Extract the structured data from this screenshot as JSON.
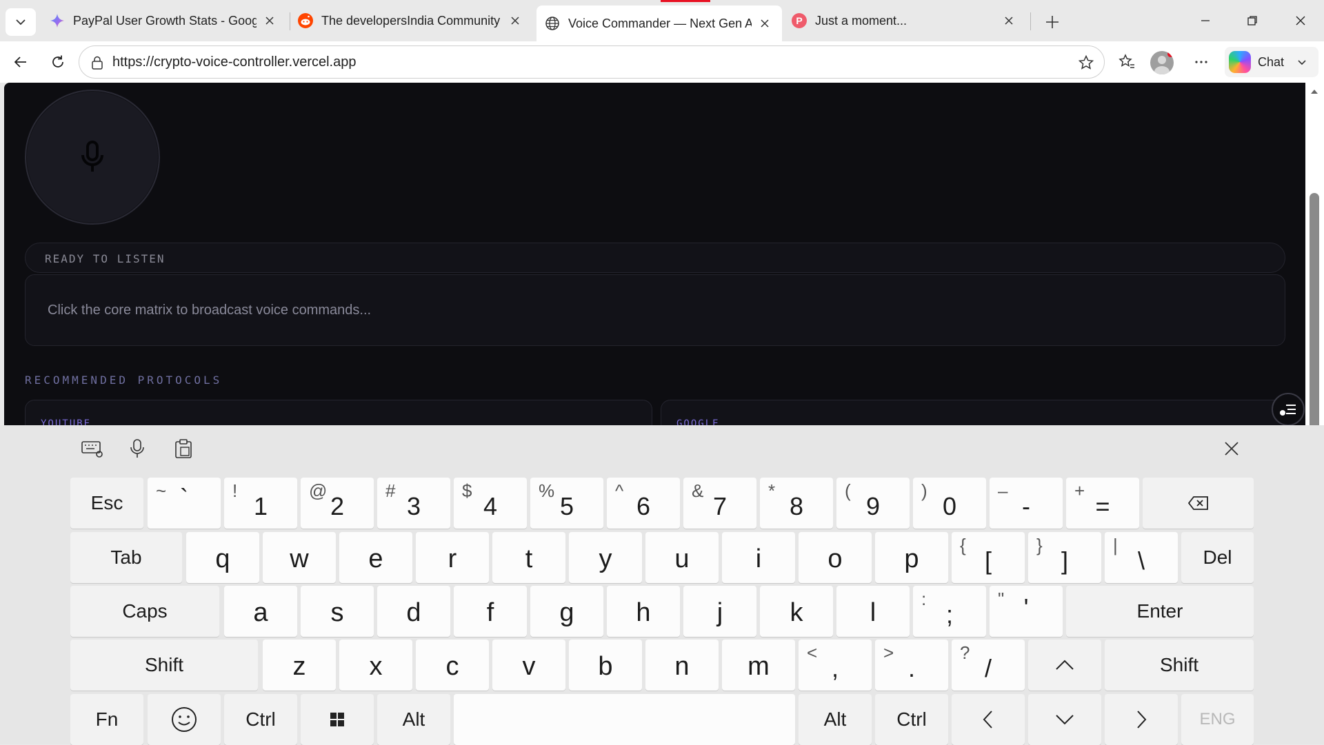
{
  "tabs": [
    {
      "title": "PayPal User Growth Stats - Google",
      "favicon": "gemini-sparkle-icon"
    },
    {
      "title": "The developersIndia Community",
      "favicon": "reddit-icon"
    },
    {
      "title": "Voice Commander — Next Gen AI",
      "favicon": "globe-icon",
      "active": true
    },
    {
      "title": "Just a moment...",
      "favicon": "perplexity-p-icon"
    }
  ],
  "toolbar": {
    "url": "https://crypto-voice-controller.vercel.app",
    "chat_label": "Chat"
  },
  "page": {
    "status": "READY TO LISTEN",
    "transcript_placeholder": "Click the core matrix to broadcast voice commands...",
    "section_label": "RECOMMENDED PROTOCOLS",
    "cards": [
      "YOUTUBE",
      "GOOGLE"
    ]
  },
  "keyboard": {
    "row1": [
      {
        "main": "Esc"
      },
      {
        "sub": "~",
        "main": "`"
      },
      {
        "sub": "!",
        "main": "1"
      },
      {
        "sub": "@",
        "main": "2"
      },
      {
        "sub": "#",
        "main": "3"
      },
      {
        "sub": "$",
        "main": "4"
      },
      {
        "sub": "%",
        "main": "5"
      },
      {
        "sub": "^",
        "main": "6"
      },
      {
        "sub": "&",
        "main": "7"
      },
      {
        "sub": "*",
        "main": "8"
      },
      {
        "sub": "(",
        "main": "9"
      },
      {
        "sub": ")",
        "main": "0"
      },
      {
        "sub": "–",
        "main": "-"
      },
      {
        "sub": "+",
        "main": "="
      }
    ],
    "row2": [
      {
        "main": "Tab"
      },
      {
        "main": "q"
      },
      {
        "main": "w"
      },
      {
        "main": "e"
      },
      {
        "main": "r"
      },
      {
        "main": "t"
      },
      {
        "main": "y"
      },
      {
        "main": "u"
      },
      {
        "main": "i"
      },
      {
        "main": "o"
      },
      {
        "main": "p"
      },
      {
        "sub": "{",
        "main": "["
      },
      {
        "sub": "}",
        "main": "]"
      },
      {
        "sub": "|",
        "main": "\\"
      },
      {
        "main": "Del"
      }
    ],
    "row3": [
      {
        "main": "Caps"
      },
      {
        "main": "a"
      },
      {
        "main": "s"
      },
      {
        "main": "d"
      },
      {
        "main": "f"
      },
      {
        "main": "g"
      },
      {
        "main": "h"
      },
      {
        "main": "j"
      },
      {
        "main": "k"
      },
      {
        "main": "l"
      },
      {
        "sub": ":",
        "main": ";"
      },
      {
        "sub": "\"",
        "main": "'"
      },
      {
        "main": "Enter"
      }
    ],
    "row4": [
      {
        "main": "Shift"
      },
      {
        "main": "z"
      },
      {
        "main": "x"
      },
      {
        "main": "c"
      },
      {
        "main": "v"
      },
      {
        "main": "b"
      },
      {
        "main": "n"
      },
      {
        "main": "m"
      },
      {
        "sub": "<",
        "main": ","
      },
      {
        "sub": ">",
        "main": "."
      },
      {
        "sub": "?",
        "main": "/"
      },
      {
        "main": "Shift"
      }
    ],
    "row5": [
      {
        "main": "Fn"
      },
      {
        "main": "Ctrl"
      },
      {
        "main": "Alt"
      },
      {
        "main": "Alt"
      },
      {
        "main": "Ctrl"
      },
      {
        "main": "ENG"
      }
    ]
  },
  "colors": {
    "content_bg": "#0d0d11",
    "accent": "#7b6cd9",
    "close_red": "#e81123"
  }
}
